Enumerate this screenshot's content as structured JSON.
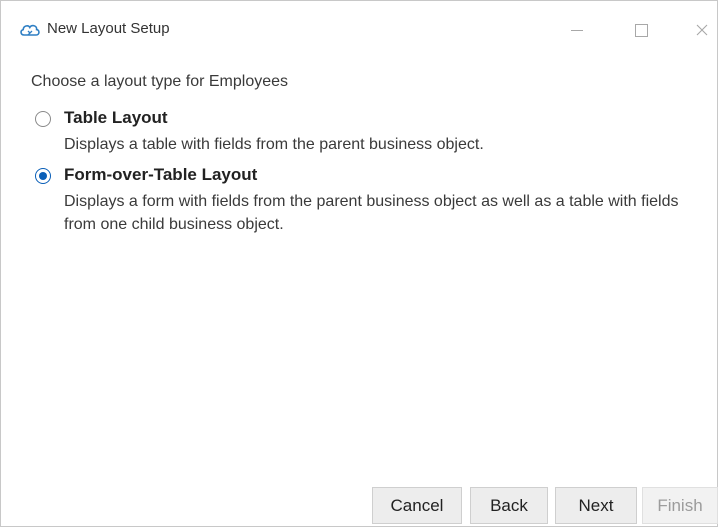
{
  "window": {
    "title": "New Layout Setup",
    "icon": "cloud-app-icon",
    "controls": {
      "minimize_icon": "minimize-icon",
      "maximize_icon": "maximize-icon",
      "close_icon": "close-icon"
    }
  },
  "prompt": "Choose a layout type for Employees",
  "options": [
    {
      "label": "Table Layout",
      "description": "Displays a table with fields from the parent business object.",
      "selected": false
    },
    {
      "label": "Form-over-Table Layout",
      "description": "Displays a form with fields from the parent business object as well as a table with fields from one child business object.",
      "selected": true
    }
  ],
  "buttons": {
    "cancel": "Cancel",
    "back": "Back",
    "next": "Next",
    "finish": "Finish",
    "finish_enabled": false
  },
  "colors": {
    "accent": "#0a5fb8",
    "button_bg": "#ededed",
    "disabled_text": "#9c9c9c"
  }
}
